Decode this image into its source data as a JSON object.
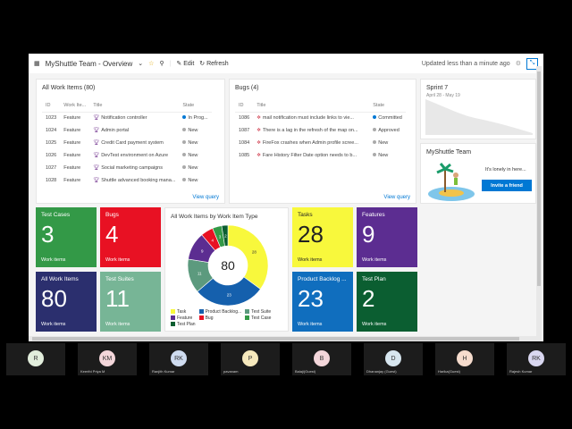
{
  "header": {
    "title": "MyShuttle Team - Overview",
    "edit": "Edit",
    "refresh": "Refresh",
    "updated": "Updated less than a minute ago"
  },
  "all_work_items": {
    "title": "All Work Items (80)",
    "columns": [
      "ID",
      "Work Ite...",
      "Title",
      "State"
    ],
    "rows": [
      [
        "1023",
        "Feature",
        "Notification controller",
        "In Prog..."
      ],
      [
        "1024",
        "Feature",
        "Admin portal",
        "New"
      ],
      [
        "1025",
        "Feature",
        "Credit Card payment system",
        "New"
      ],
      [
        "1026",
        "Feature",
        "DevTest environment on Azure",
        "New"
      ],
      [
        "1027",
        "Feature",
        "Social marketing campaigns",
        "New"
      ],
      [
        "1028",
        "Feature",
        "Shuttle advanced booking mana...",
        "New"
      ]
    ],
    "view_query": "View query"
  },
  "bugs": {
    "title": "Bugs (4)",
    "columns": [
      "ID",
      "Title",
      "State"
    ],
    "rows": [
      [
        "1086",
        "mail notification must include links to vie...",
        "Committed"
      ],
      [
        "1087",
        "There is a lag in the refresh of the map on...",
        "Approved"
      ],
      [
        "1084",
        "FireFox crashes when Admin profile scree...",
        "New"
      ],
      [
        "1085",
        "Fare History Filter Date option needs to b...",
        "New"
      ]
    ],
    "view_query": "View query"
  },
  "sprint": {
    "title": "Sprint 7",
    "dates": "April 28 - May 19"
  },
  "team": {
    "title": "MyShuttle Team",
    "lonely": "It's lonely in here...",
    "invite": "Invite a friend"
  },
  "tiles": [
    {
      "title": "Test Cases",
      "value": "3",
      "sub": "Work items",
      "color": "#339947"
    },
    {
      "title": "Bugs",
      "value": "4",
      "sub": "Work items",
      "color": "#e81123"
    },
    {
      "title": "Tasks",
      "value": "28",
      "sub": "Work items",
      "color": "#f8f83c"
    },
    {
      "title": "Features",
      "value": "9",
      "sub": "Work items",
      "color": "#5c2d91"
    },
    {
      "title": "All Work Items",
      "value": "80",
      "sub": "Work items",
      "color": "#2b2f6e"
    },
    {
      "title": "Test Suites",
      "value": "11",
      "sub": "Work items",
      "color": "#77b596"
    },
    {
      "title": "Product Backlog ...",
      "value": "23",
      "sub": "Work items",
      "color": "#106ebe"
    },
    {
      "title": "Test Plan",
      "value": "2",
      "sub": "Work items",
      "color": "#0b5e31"
    }
  ],
  "chart_data": {
    "type": "pie",
    "title": "All Work Items by Work Item Type",
    "total": "80",
    "categories": [
      "Task",
      "Product Backlog...",
      "Test Suite",
      "Feature",
      "Bug",
      "Test Case",
      "Test Plan"
    ],
    "values": [
      28,
      23,
      11,
      9,
      4,
      3,
      2
    ],
    "colors": [
      "#f8f83c",
      "#1560ad",
      "#5c9a7e",
      "#5c2d91",
      "#e81123",
      "#339947",
      "#0b5e31"
    ]
  },
  "participants": [
    {
      "initials": "R",
      "name": "",
      "color": "#e2eedc"
    },
    {
      "initials": "KM",
      "name": "Keerthi Priya M",
      "color": "#f3d6da"
    },
    {
      "initials": "RK",
      "name": "Ranjith Kumar",
      "color": "#cfdcf0"
    },
    {
      "initials": "P",
      "name": "pavanam",
      "color": "#f6e9bd"
    },
    {
      "initials": "B",
      "name": "Balaji(Guest)",
      "color": "#f3d6da"
    },
    {
      "initials": "D",
      "name": "Dhananjay (Guest)",
      "color": "#d7e6ef"
    },
    {
      "initials": "H",
      "name": "Harika(Guest)",
      "color": "#f6dccd"
    },
    {
      "initials": "RK",
      "name": "Rajesh Kumar",
      "color": "#d9d7f0"
    }
  ]
}
